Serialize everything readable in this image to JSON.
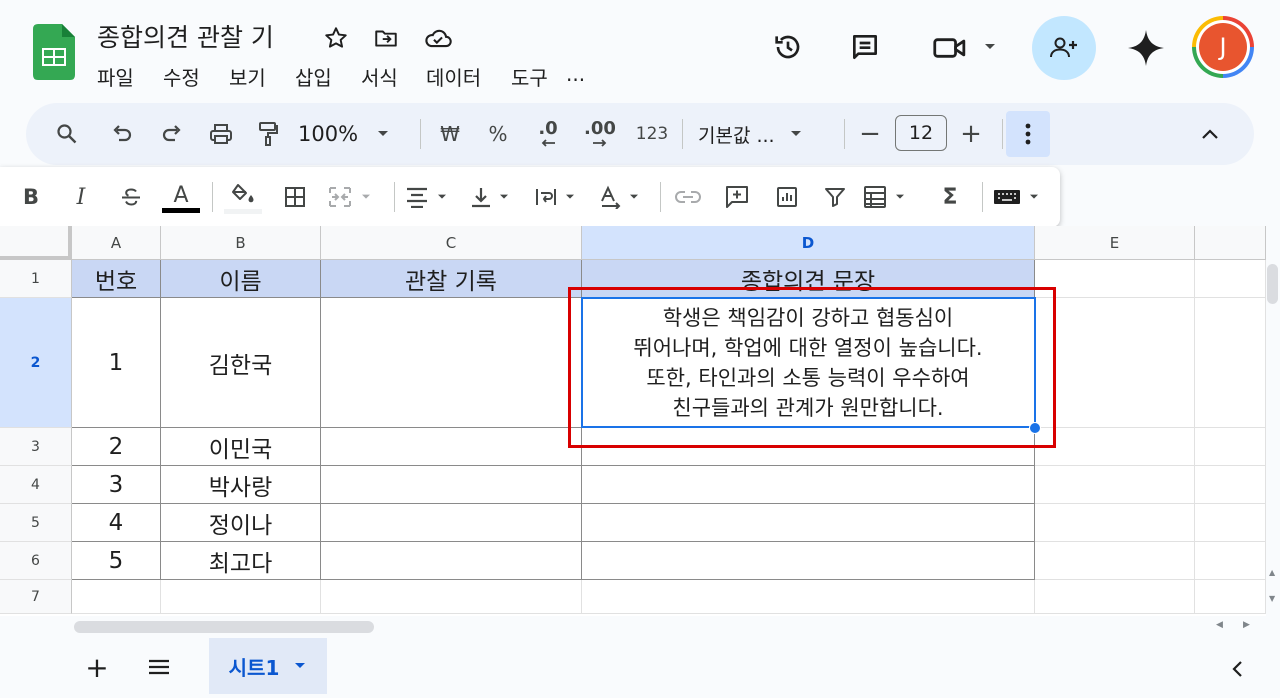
{
  "app": {
    "doc_title": "종합의견 관찰 기",
    "avatar_letter": "J",
    "menu": [
      "파일",
      "수정",
      "보기",
      "삽입",
      "서식",
      "데이터",
      "도구",
      "..."
    ]
  },
  "toolbar": {
    "zoom": "100%",
    "currency": "₩",
    "percent": "%",
    "dec_decrease": ".0",
    "dec_increase": ".00",
    "number_format": "123",
    "font": "기본값 ...",
    "font_size": "12",
    "minus": "−",
    "plus": "+",
    "bold": "B",
    "italic": "I",
    "text_color_letter": "A",
    "function_symbol": "Σ"
  },
  "grid": {
    "column_headers": [
      "A",
      "B",
      "C",
      "D",
      "E"
    ],
    "row_headers": [
      "1",
      "2",
      "3",
      "4",
      "5",
      "6",
      "7"
    ],
    "header_row": [
      "번호",
      "이름",
      "관찰 기록",
      "종합의견 문장"
    ],
    "rows": [
      {
        "num": "1",
        "name": "김한국",
        "note": "",
        "summary": [
          "학생은 책임감이 강하고 협동심이",
          "뛰어나며, 학업에 대한 열정이 높습니다.",
          "또한, 타인과의 소통 능력이 우수하여",
          "친구들과의 관계가 원만합니다."
        ]
      },
      {
        "num": "2",
        "name": "이민국",
        "note": "",
        "summary": []
      },
      {
        "num": "3",
        "name": "박사랑",
        "note": "",
        "summary": []
      },
      {
        "num": "4",
        "name": "정이나",
        "note": "",
        "summary": []
      },
      {
        "num": "5",
        "name": "최고다",
        "note": "",
        "summary": []
      }
    ]
  },
  "sheet_tabs": {
    "add": "+",
    "active_tab": "시트1"
  },
  "colors": {
    "accent": "#0b57d0",
    "header_fill": "#c9d7f4",
    "highlight_box": "#d80000",
    "selection": "#1a73e8",
    "avatar_bg": "#e8552f"
  }
}
